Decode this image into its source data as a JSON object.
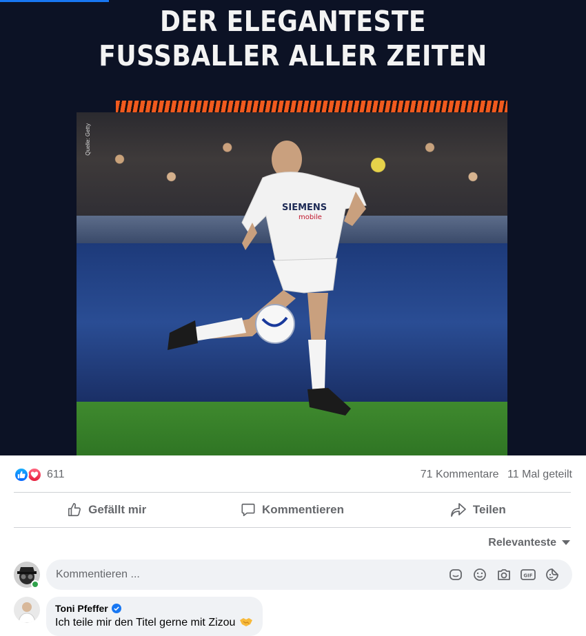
{
  "post": {
    "headline_line1": "DER ELEGANTESTE",
    "headline_line2": "FUSSBALLER ALLER ZEITEN",
    "photo_credit": "Quelle: Getty",
    "jersey_sponsor": "SIEMENS",
    "jersey_sponsor_sub": "mobile"
  },
  "reactions": {
    "count": "611",
    "comments": "71 Kommentare",
    "shares": "11 Mal geteilt",
    "icons": [
      "like-icon",
      "love-icon"
    ]
  },
  "actions": {
    "like_label": "Gefällt mir",
    "comment_label": "Kommentieren",
    "share_label": "Teilen"
  },
  "sort": {
    "label": "Relevanteste"
  },
  "composer": {
    "placeholder": "Kommentieren ...",
    "icons": [
      "sticker-icon",
      "emoji-icon",
      "camera-icon",
      "gif-icon",
      "avatar-sticker-icon"
    ]
  },
  "comment": {
    "author": "Toni Pfeffer",
    "text": "Ich teile mir den Titel gerne mit Zizou",
    "emoji": "handshake-icon"
  },
  "colors": {
    "accent": "#1877f2",
    "secondary_text": "#65676b",
    "bubble_bg": "#f0f2f5",
    "image_bg": "#0c1225",
    "orange": "#f05a1e"
  }
}
